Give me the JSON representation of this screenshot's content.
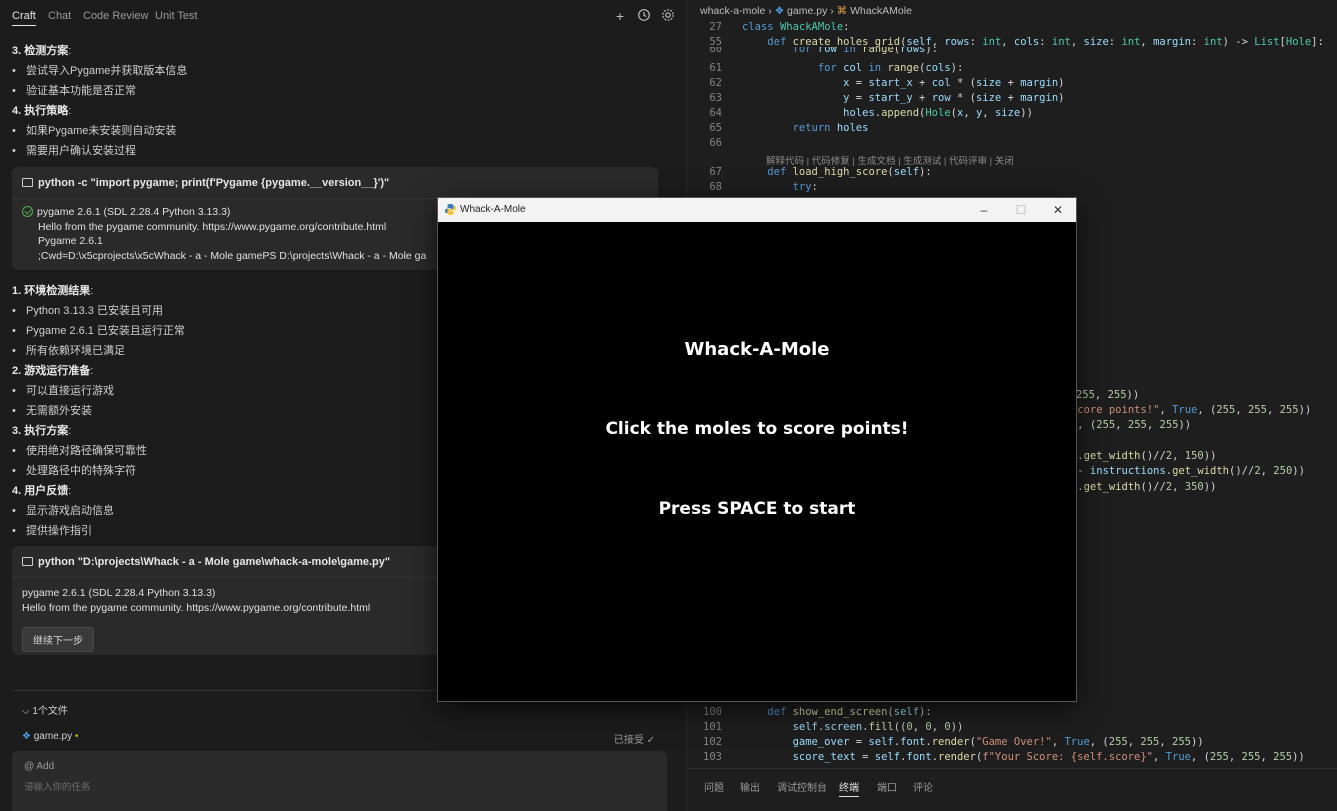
{
  "left_panel": {
    "tabs": [
      "Craft",
      "Chat",
      "Code Review",
      "Unit Test"
    ],
    "top_icons": [
      "add-icon",
      "history-icon",
      "settings-icon"
    ],
    "lines_top": [
      {
        "kind": "num",
        "text": "3. 检测方案",
        "suffix": ":"
      },
      {
        "kind": "bullet",
        "text": "尝试导入Pygame并获取版本信息"
      },
      {
        "kind": "bullet",
        "text": "验证基本功能是否正常"
      },
      {
        "kind": "num",
        "text": "4. 执行策略",
        "suffix": ":"
      },
      {
        "kind": "bullet",
        "text": "如果Pygame未安装则自动安装"
      },
      {
        "kind": "bullet",
        "text": "需要用户确认安装过程"
      }
    ],
    "cmd1": {
      "command": "python -c \"import pygame; print(f'Pygame {pygame.__version__}')\"",
      "output": [
        "pygame 2.6.1 (SDL 2.28.4 Python 3.13.3)",
        "Hello from the pygame community. https://www.pygame.org/contribute.html",
        "Pygame 2.6.1",
        ";Cwd=D:\\x5cprojects\\x5cWhack - a - Mole game\u0007PS D:\\projects\\Whack - a - Mole ga"
      ]
    },
    "lines_mid": [
      {
        "kind": "num",
        "text": "1. 环境检测结果",
        "suffix": ":"
      },
      {
        "kind": "bullet",
        "text": "Python 3.13.3 已安装且可用"
      },
      {
        "kind": "bullet",
        "text": "Pygame 2.6.1 已安装且运行正常"
      },
      {
        "kind": "bullet",
        "text": "所有依赖环境已满足"
      },
      {
        "kind": "num",
        "text": "2. 游戏运行准备",
        "suffix": ":"
      },
      {
        "kind": "bullet",
        "text": "可以直接运行游戏"
      },
      {
        "kind": "bullet",
        "text": "无需额外安装"
      },
      {
        "kind": "num",
        "text": "3. 执行方案",
        "suffix": ":"
      },
      {
        "kind": "bullet",
        "text": "使用绝对路径确保可靠性"
      },
      {
        "kind": "bullet",
        "text": "处理路径中的特殊字符"
      },
      {
        "kind": "num",
        "text": "4. 用户反馈",
        "suffix": ":"
      },
      {
        "kind": "bullet",
        "text": "显示游戏启动信息"
      },
      {
        "kind": "bullet",
        "text": "提供操作指引"
      }
    ],
    "cmd2": {
      "command": "python \"D:\\projects\\Whack - a - Mole game\\whack-a-mole\\game.py\"",
      "output": [
        "pygame 2.6.1 (SDL 2.28.4 Python 3.13.3)",
        "Hello from the pygame community. https://www.pygame.org/contribute.html"
      ],
      "button": "继续下一步"
    },
    "files_header": "1个文件",
    "file_name": "game.py",
    "file_status": "已接受 ✓",
    "composer_add": "@ Add",
    "composer_placeholder": "请输入你的任务"
  },
  "editor": {
    "breadcrumbs": [
      "whack-a-mole",
      "game.py",
      "WhackAMole"
    ],
    "codelens": "解释代码 | 代码修复 | 生成文档 | 生成测试 | 代码评审 | 关闭",
    "panel_tabs": [
      "问题",
      "输出",
      "调试控制台",
      "终端",
      "端口",
      "评论"
    ],
    "active_panel_tab": 3
  },
  "game_window": {
    "title": "Whack-A-Mole",
    "heading": "Whack-A-Mole",
    "instructions": "Click the moles to score points!",
    "start": "Press SPACE to start",
    "controls": [
      "minimize-icon",
      "maximize-icon",
      "close-icon"
    ]
  }
}
